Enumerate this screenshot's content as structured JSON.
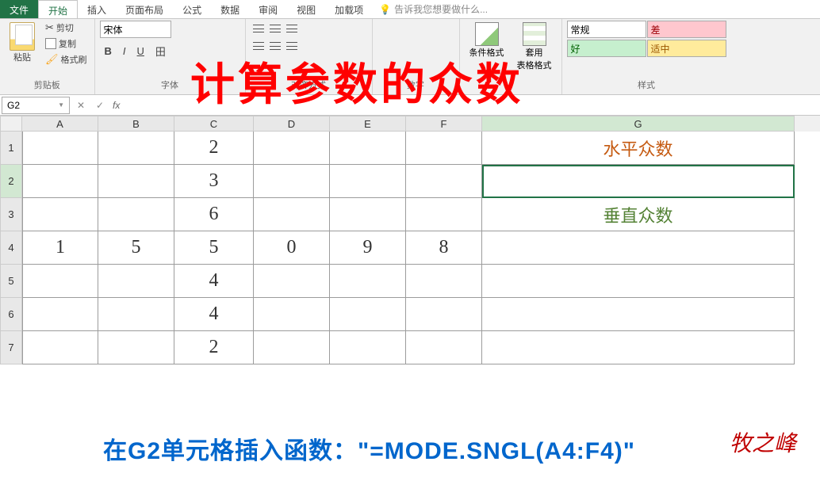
{
  "tabs": {
    "file": "文件",
    "home": "开始",
    "insert": "插入",
    "layout": "页面布局",
    "formula": "公式",
    "data": "数据",
    "review": "审阅",
    "view": "视图",
    "addins": "加载项",
    "tellme": "告诉我您想要做什么..."
  },
  "ribbon": {
    "clipboard": {
      "label": "剪贴板",
      "paste": "粘贴",
      "cut": "剪切",
      "copy": "复制",
      "format_painter": "格式刷"
    },
    "font": {
      "label": "字体",
      "name": "宋体"
    },
    "align": {
      "label": "对齐方式"
    },
    "number": {
      "label": "数字",
      "general": "常规"
    },
    "styles": {
      "label": "样式",
      "cond": "条件格式",
      "table": "套用\n表格格式",
      "normal": "常规",
      "bad": "差",
      "good": "好",
      "neutral": "适中"
    }
  },
  "overlay": "计算参数的众数",
  "namebox": "G2",
  "cols": [
    "A",
    "B",
    "C",
    "D",
    "E",
    "F",
    "G"
  ],
  "rows": [
    "1",
    "2",
    "3",
    "4",
    "5",
    "6",
    "7"
  ],
  "cells": {
    "C1": "2",
    "G1": "水平众数",
    "C2": "3",
    "C3": "6",
    "G3": "垂直众数",
    "A4": "1",
    "B4": "5",
    "C4": "5",
    "D4": "0",
    "E4": "9",
    "F4": "8",
    "C5": "4",
    "C6": "4",
    "C7": "2"
  },
  "bottom_text": "在G2单元格插入函数：\"=MODE.SNGL(A4:F4)\"",
  "signature": "牧之峰"
}
